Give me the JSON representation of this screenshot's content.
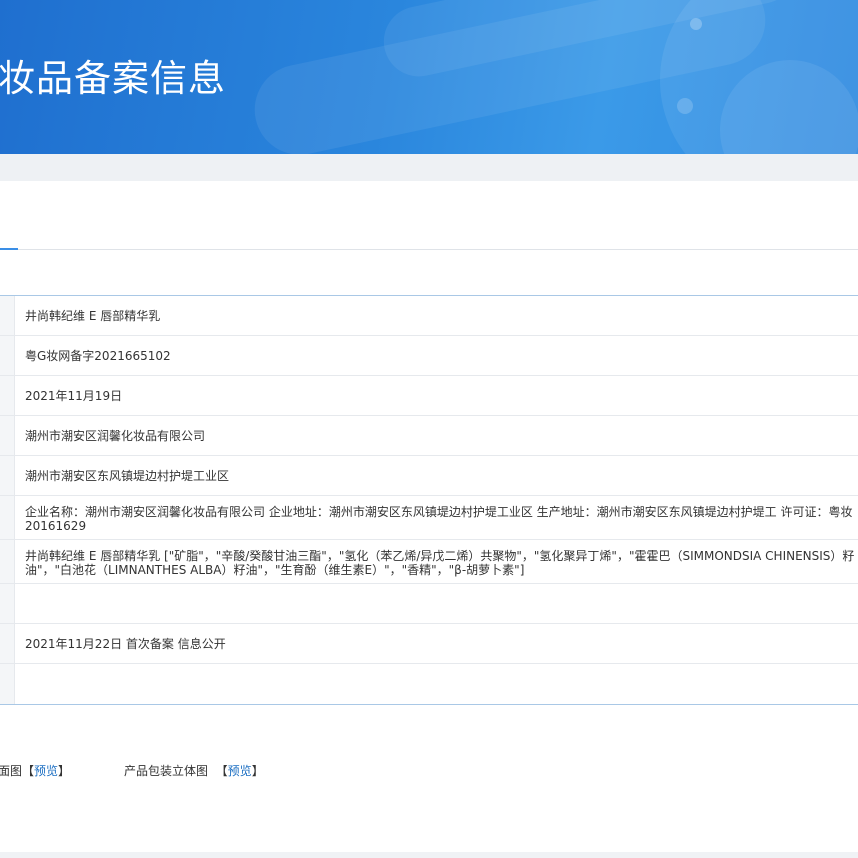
{
  "header": {
    "title": "妆品备案信息",
    "colors": {
      "banner_start": "#1f6fcf",
      "banner_end": "#3b9ae8"
    }
  },
  "table": {
    "rows": [
      {
        "value": "井尚韩纪维 E 唇部精华乳"
      },
      {
        "value": "粤G妆网备字2021665102"
      },
      {
        "value": "2021年11月19日"
      },
      {
        "value": "潮州市潮安区润馨化妆品有限公司"
      },
      {
        "value": "潮州市潮安区东风镇堤边村护堤工业区"
      },
      {
        "value": "企业名称：潮州市潮安区润馨化妆品有限公司 企业地址：潮州市潮安区东风镇堤边村护堤工业区 生产地址：潮州市潮安区东风镇堤边村护堤工 许可证：粤妆20161629"
      },
      {
        "value": "井尚韩纪维 E 唇部精华乳 [\"矿脂\"，\"辛酸/癸酸甘油三酯\"，\"氢化（苯乙烯/异戊二烯）共聚物\"，\"氢化聚异丁烯\"，\"霍霍巴（SIMMONDSIA CHINENSIS）籽油\"，\"白池花（LIMNANTHES ALBA）籽油\"，\"生育酚（维生素E）\"，\"香精\"，\"β-胡萝卜素\"]"
      },
      {
        "value": ""
      },
      {
        "value": "2021年11月22日 首次备案 信息公开"
      },
      {
        "value": ""
      }
    ]
  },
  "attachments": {
    "item1_label": "面图",
    "item1_link": "预览",
    "item2_label": "产品包装立体图",
    "item2_link": "预览",
    "bracket_open": "【",
    "bracket_close": "】"
  }
}
